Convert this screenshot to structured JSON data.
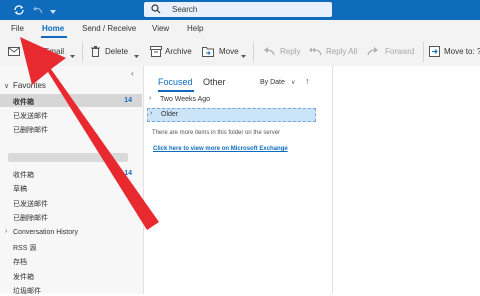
{
  "titlebar": {
    "search_placeholder": "Search"
  },
  "menu": {
    "file": "File",
    "home": "Home",
    "send_receive": "Send / Receive",
    "view": "View",
    "help": "Help"
  },
  "ribbon": {
    "email": "Email",
    "delete": "Delete",
    "archive": "Archive",
    "move": "Move",
    "reply": "Reply",
    "reply_all": "Reply All",
    "forward": "Forward",
    "move_to": "Move to: ?"
  },
  "folders": {
    "favorites_header": "Favorites",
    "favorites": [
      {
        "label": "收件箱",
        "count": "14",
        "selected": true
      },
      {
        "label": "已发送邮件",
        "count": ""
      },
      {
        "label": "已删除邮件",
        "count": ""
      }
    ],
    "account": [
      {
        "label": "收件箱",
        "count": "14"
      },
      {
        "label": "草稿",
        "count": ""
      },
      {
        "label": "已发送邮件",
        "count": ""
      },
      {
        "label": "已删除邮件",
        "count": ""
      }
    ],
    "conversation_history": "Conversation History",
    "more": [
      "RSS 源",
      "存档",
      "发件箱",
      "垃圾邮件"
    ]
  },
  "list": {
    "tab_focused": "Focused",
    "tab_other": "Other",
    "sort": "By Date",
    "groups": [
      "Two Weeks Ago",
      "Older"
    ],
    "server_msg": "There are more items in this folder on the server",
    "exchange_link": "Click here to view more on Microsoft Exchange"
  },
  "colors": {
    "accent": "#0f6cbd",
    "arrow": "#e8292f",
    "selected_group": "#cce4f7"
  }
}
